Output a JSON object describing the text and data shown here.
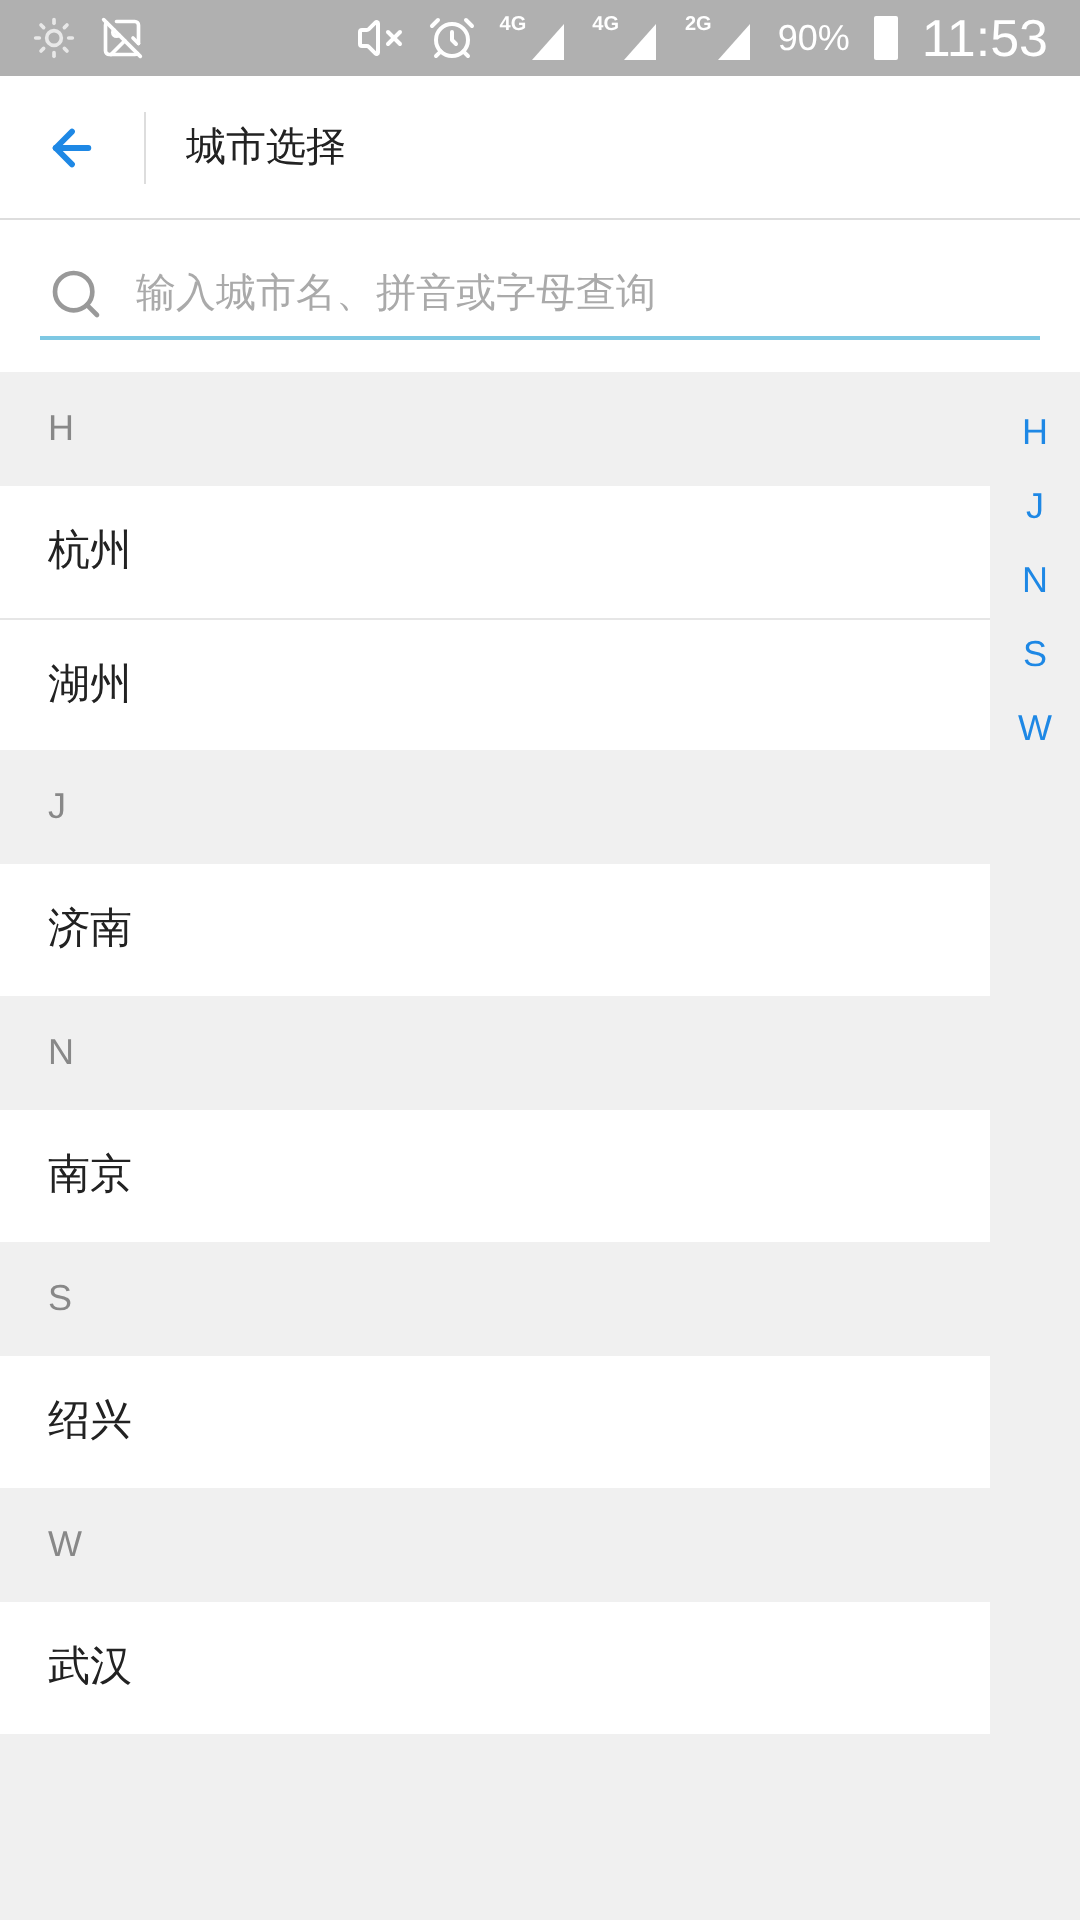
{
  "status_bar": {
    "network_labels": [
      "4G",
      "4G",
      "2G"
    ],
    "battery": "90%",
    "time": "11:53"
  },
  "header": {
    "title": "城市选择"
  },
  "search": {
    "placeholder": "输入城市名、拼音或字母查询"
  },
  "sections": [
    {
      "letter": "H",
      "cities": [
        "杭州",
        "湖州"
      ]
    },
    {
      "letter": "J",
      "cities": [
        "济南"
      ]
    },
    {
      "letter": "N",
      "cities": [
        "南京"
      ]
    },
    {
      "letter": "S",
      "cities": [
        "绍兴"
      ]
    },
    {
      "letter": "W",
      "cities": [
        "武汉"
      ]
    }
  ],
  "index": [
    "H",
    "J",
    "N",
    "S",
    "W"
  ]
}
